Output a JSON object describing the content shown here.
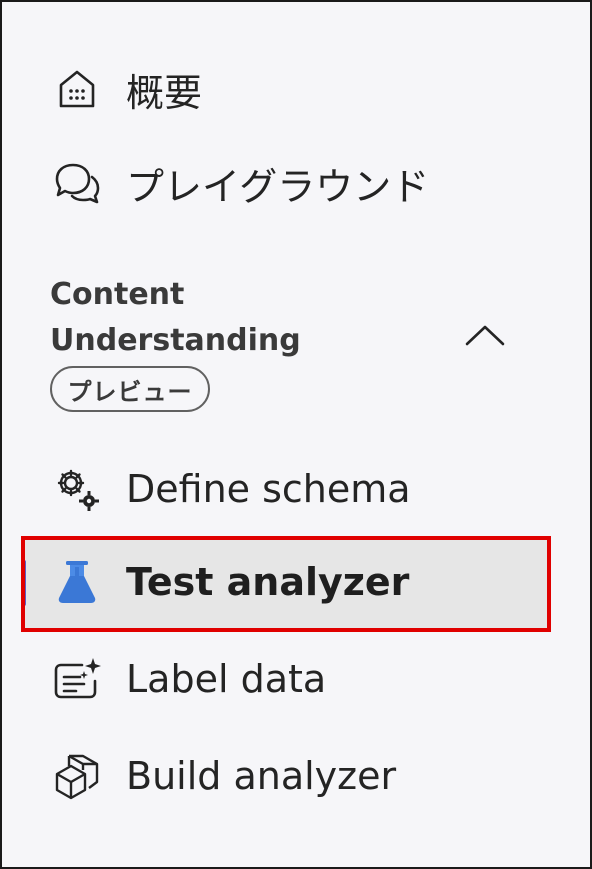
{
  "nav": {
    "overview": {
      "label": "概要",
      "icon": "home-icon"
    },
    "playground": {
      "label": "プレイグラウンド",
      "icon": "chat-icon"
    }
  },
  "section": {
    "title_line1": "Content",
    "title_line2": "Understanding",
    "badge": "プレビュー",
    "collapse_icon": "chevron-up-icon",
    "items": [
      {
        "label": "Define schema",
        "icon": "gear-icon",
        "selected": false
      },
      {
        "label": "Test analyzer",
        "icon": "flask-icon",
        "selected": true
      },
      {
        "label": "Label data",
        "icon": "sparkle-document-icon",
        "selected": false
      },
      {
        "label": "Build analyzer",
        "icon": "cube-icon",
        "selected": false
      }
    ]
  },
  "colors": {
    "selected_background": "#e6e6e6",
    "selected_indicator": "#5b5fc7",
    "highlight_outline": "#e00000",
    "flask_icon": "#3b78d6"
  }
}
